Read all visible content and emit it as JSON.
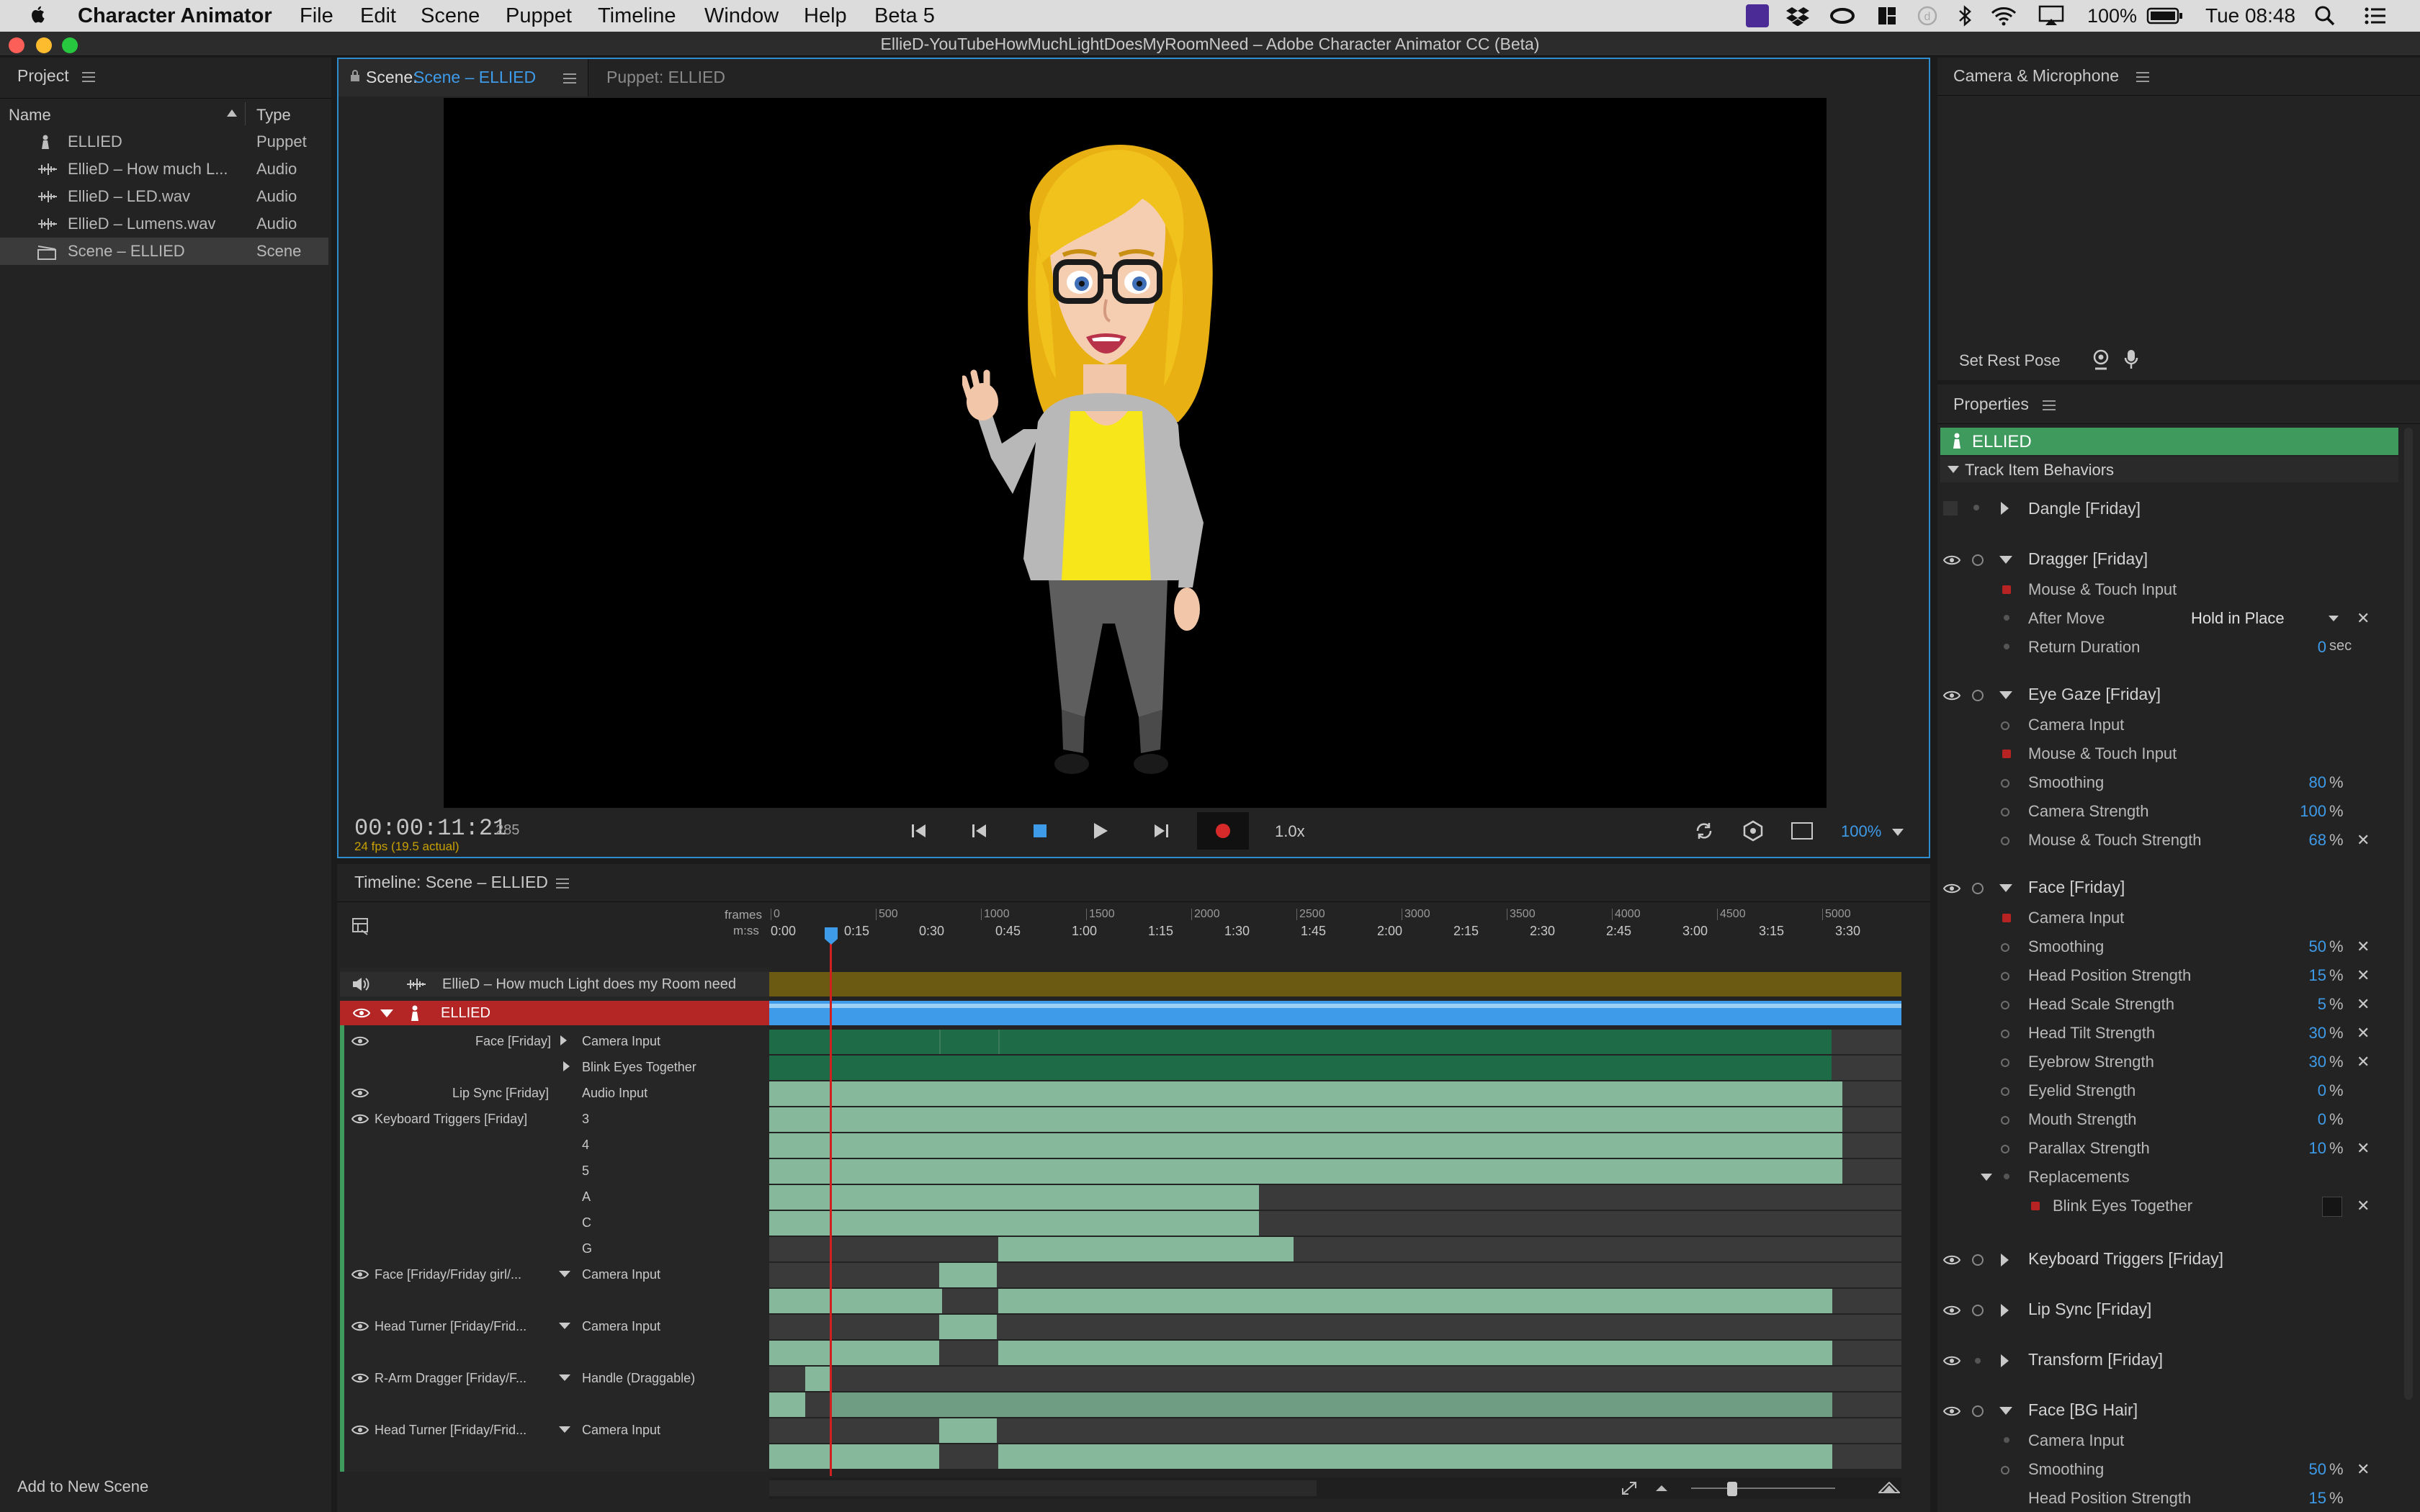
{
  "menubar": {
    "app_name": "Character Animator",
    "items": [
      "File",
      "Edit",
      "Scene",
      "Puppet",
      "Timeline",
      "Window",
      "Help",
      "Beta 5"
    ],
    "battery": "100%",
    "clock": "Tue 08:48"
  },
  "window": {
    "title": "EllieD-YouTubeHowMuchLightDoesMyRoomNeed – Adobe Character Animator CC (Beta)"
  },
  "project": {
    "panel_title": "Project",
    "col_name": "Name",
    "col_type": "Type",
    "items": [
      {
        "name": "ELLIED",
        "type": "Puppet",
        "icon": "puppet-icon"
      },
      {
        "name": "EllieD – How much L...",
        "type": "Audio",
        "icon": "audio-icon"
      },
      {
        "name": "EllieD – LED.wav",
        "type": "Audio",
        "icon": "audio-icon"
      },
      {
        "name": "EllieD – Lumens.wav",
        "type": "Audio",
        "icon": "audio-icon"
      },
      {
        "name": "Scene – ELLIED",
        "type": "Scene",
        "icon": "scene-icon",
        "selected": true
      }
    ],
    "footer": "Add to New Scene"
  },
  "scene_panel": {
    "tab_scene_prefix": "Scene:",
    "tab_scene_name": "Scene – ELLIED",
    "tab_puppet": "Puppet: ELLIED",
    "timecode": "00:00:11:21",
    "frame": "285",
    "fps": "24 fps (19.5 actual)",
    "speed": "1.0x",
    "zoom": "100%"
  },
  "camera": {
    "panel_title": "Camera & Microphone",
    "set_rest_pose": "Set Rest Pose"
  },
  "timeline": {
    "panel_title": "Timeline: Scene – ELLIED",
    "ruler_frames_label": "frames",
    "ruler_time_label": "m:ss",
    "frame_ticks": [
      "0",
      "500",
      "1000",
      "1500",
      "2000",
      "2500",
      "3000",
      "3500",
      "4000",
      "4500",
      "5000"
    ],
    "time_ticks": [
      "0:00",
      "0:15",
      "0:30",
      "0:45",
      "1:00",
      "1:15",
      "1:30",
      "1:45",
      "2:00",
      "2:15",
      "2:30",
      "2:45",
      "3:00",
      "3:15",
      "3:30"
    ],
    "audio_track": "EllieD – How much Light does my Room need",
    "puppet_track": "ELLIED",
    "rows": [
      {
        "behavior": "Face [Friday]",
        "param": "Camera Input"
      },
      {
        "behavior": "",
        "param": "Blink Eyes Together"
      },
      {
        "behavior": "Lip Sync [Friday]",
        "param": "Audio Input"
      },
      {
        "behavior": "Keyboard Triggers [Friday]",
        "param": "3"
      },
      {
        "behavior": "",
        "param": "4"
      },
      {
        "behavior": "",
        "param": "5"
      },
      {
        "behavior": "",
        "param": "A"
      },
      {
        "behavior": "",
        "param": "C"
      },
      {
        "behavior": "",
        "param": "G"
      },
      {
        "behavior": "Face [Friday/Friday girl/...",
        "param": "Camera Input"
      },
      {
        "behavior": "Head Turner [Friday/Frid...",
        "param": "Camera Input"
      },
      {
        "behavior": "R-Arm Dragger [Friday/F...",
        "param": "Handle (Draggable)"
      },
      {
        "behavior": "Head Turner [Friday/Frid...",
        "param": "Camera Input"
      }
    ]
  },
  "properties": {
    "panel_title": "Properties",
    "puppet_name": "ELLIED",
    "section": "Track Item Behaviors",
    "dangle": "Dangle [Friday]",
    "dragger": {
      "title": "Dragger [Friday]",
      "params": [
        {
          "label": "Mouse & Touch Input",
          "value": ""
        },
        {
          "label": "After Move",
          "value": "Hold in Place"
        },
        {
          "label": "Return Duration",
          "value": "0",
          "unit": "sec"
        }
      ]
    },
    "eye_gaze": {
      "title": "Eye Gaze [Friday]",
      "params": [
        {
          "label": "Camera Input",
          "value": "",
          "unit": ""
        },
        {
          "label": "Mouse & Touch Input",
          "value": "",
          "unit": ""
        },
        {
          "label": "Smoothing",
          "value": "80",
          "unit": "%"
        },
        {
          "label": "Camera Strength",
          "value": "100",
          "unit": "%"
        },
        {
          "label": "Mouse & Touch Strength",
          "value": "68",
          "unit": "%"
        }
      ]
    },
    "face": {
      "title": "Face [Friday]",
      "params": [
        {
          "label": "Camera Input",
          "value": "",
          "unit": ""
        },
        {
          "label": "Smoothing",
          "value": "50",
          "unit": "%"
        },
        {
          "label": "Head Position Strength",
          "value": "15",
          "unit": "%"
        },
        {
          "label": "Head Scale Strength",
          "value": "5",
          "unit": "%"
        },
        {
          "label": "Head Tilt Strength",
          "value": "30",
          "unit": "%"
        },
        {
          "label": "Eyebrow Strength",
          "value": "30",
          "unit": "%"
        },
        {
          "label": "Eyelid Strength",
          "value": "0",
          "unit": "%"
        },
        {
          "label": "Mouth Strength",
          "value": "0",
          "unit": "%"
        },
        {
          "label": "Parallax Strength",
          "value": "10",
          "unit": "%"
        }
      ],
      "replacements": "Replacements",
      "replacement_item": "Blink Eyes Together"
    },
    "keyboard_triggers": "Keyboard Triggers [Friday]",
    "lip_sync": "Lip Sync [Friday]",
    "transform": "Transform [Friday]",
    "face_bg_hair": {
      "title": "Face [BG Hair]",
      "params": [
        {
          "label": "Camera Input",
          "value": "",
          "unit": ""
        },
        {
          "label": "Smoothing",
          "value": "50",
          "unit": "%"
        },
        {
          "label": "Head Position Strength",
          "value": "15",
          "unit": "%"
        }
      ]
    }
  },
  "colors": {
    "accent_blue": "#3e9bea",
    "puppet_green": "#3f9a5e",
    "track_red": "#b42626",
    "audio_gold": "#6b5a12",
    "take_green": "#86b89b"
  }
}
